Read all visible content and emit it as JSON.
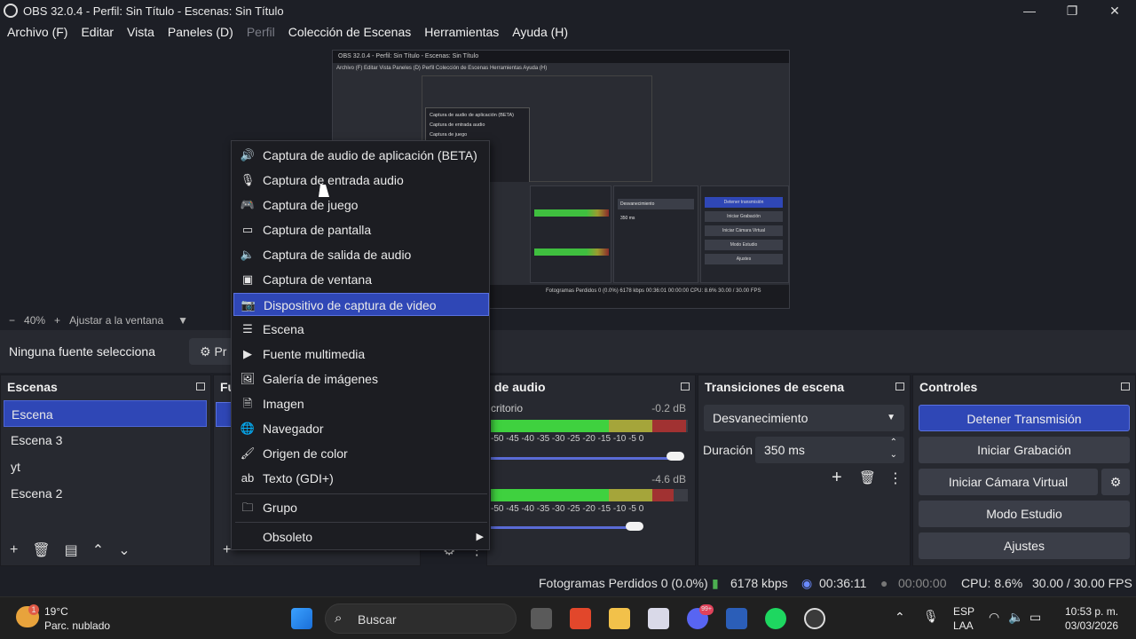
{
  "window": {
    "title": "OBS 32.0.4 - Perfil: Sin Título - Escenas: Sin Título"
  },
  "menu": {
    "items": [
      "Archivo (F)",
      "Editar",
      "Vista",
      "Paneles (D)",
      "Perfil",
      "Colección de Escenas",
      "Herramientas",
      "Ayuda (H)"
    ]
  },
  "zoom": {
    "minus": "−",
    "value": "40%",
    "plus": "+",
    "fit": "Ajustar a la ventana"
  },
  "source_bar": {
    "no_source": "Ninguna fuente selecciona",
    "properties": "Pr"
  },
  "scenes": {
    "title": "Escenas",
    "items": [
      "Escena",
      "Escena 3",
      "yt",
      "Escena 2"
    ]
  },
  "sources": {
    "title": "Fu"
  },
  "audio": {
    "title": "de audio",
    "ch1_name": "critorio",
    "ch1_db": "-0.2 dB",
    "ch2_db": "-4.6 dB",
    "ticks": "-50 -45 -40 -35 -30 -25 -20 -15 -10  -5   0",
    "ch1_level": 0.99,
    "ch2_level": 0.93
  },
  "transitions": {
    "title": "Transiciones de escena",
    "type": "Desvanecimiento",
    "duration_label": "Duración",
    "duration_value": "350 ms"
  },
  "controls": {
    "title": "Controles",
    "stop_stream": "Detener Transmisión",
    "start_record": "Iniciar Grabación",
    "virtual_cam": "Iniciar Cámara Virtual",
    "studio": "Modo Estudio",
    "settings": "Ajustes"
  },
  "status": {
    "dropped": "Fotogramas Perdidos 0 (0.0%)",
    "kbps": "6178 kbps",
    "stream_time": "00:36:11",
    "rec_time": "00:00:00",
    "cpu": "CPU: 8.6%",
    "fps": "30.00 / 30.00 FPS"
  },
  "context_menu": {
    "items": [
      {
        "icon": "app-audio-icon",
        "label": "Captura de audio de aplicación (BETA)"
      },
      {
        "icon": "microphone-icon",
        "label": "Captura de entrada audio"
      },
      {
        "icon": "gamepad-icon",
        "label": "Captura de juego"
      },
      {
        "icon": "monitor-icon",
        "label": "Captura de pantalla"
      },
      {
        "icon": "speaker-icon",
        "label": "Captura de salida de audio"
      },
      {
        "icon": "window-icon",
        "label": "Captura de ventana"
      },
      {
        "icon": "camera-icon",
        "label": "Dispositivo de captura de video"
      },
      {
        "icon": "list-icon",
        "label": "Escena"
      },
      {
        "icon": "play-icon",
        "label": "Fuente multimedia"
      },
      {
        "icon": "gallery-icon",
        "label": "Galería de imágenes"
      },
      {
        "icon": "image-icon",
        "label": "Imagen"
      },
      {
        "icon": "globe-icon",
        "label": "Navegador"
      },
      {
        "icon": "brush-icon",
        "label": "Origen de color"
      },
      {
        "icon": "text-icon",
        "label": "Texto (GDI+)"
      }
    ],
    "group": "Grupo",
    "obsolete": "Obsoleto"
  },
  "preview_mini": {
    "title": "OBS 32.0.4 - Perfil: Sin Título - Escenas: Sin Título",
    "menu": "Archivo (F)   Editar   Vista   Paneles (D)   Perfil   Colección de Escenas   Herramientas   Ayuda (H)",
    "popup": [
      "Captura de audio de aplicación (BETA)",
      "Captura de entrada audio",
      "Captura de juego"
    ],
    "status": "Fotogramas Perdidos 0 (0.0%)   6178 kbps   00:36:01   00:00:00   CPU: 8.6%   30.00 / 30.00 FPS",
    "btns": [
      "Detener transmisión",
      "Iniciar Grabación",
      "Iniciar Cámara Virtual",
      "Modo Estudio",
      "Ajustes"
    ],
    "trans": "Desvanecimiento",
    "dur": "350 ms"
  },
  "taskbar": {
    "weather_temp": "19°C",
    "weather_desc": "Parc. nublado",
    "search": "Buscar",
    "lang1": "ESP",
    "lang2": "LAA",
    "time": "10:53 p. m.",
    "date": "03/03/2026",
    "badge_weather": "1",
    "badge_discord": "99+"
  }
}
